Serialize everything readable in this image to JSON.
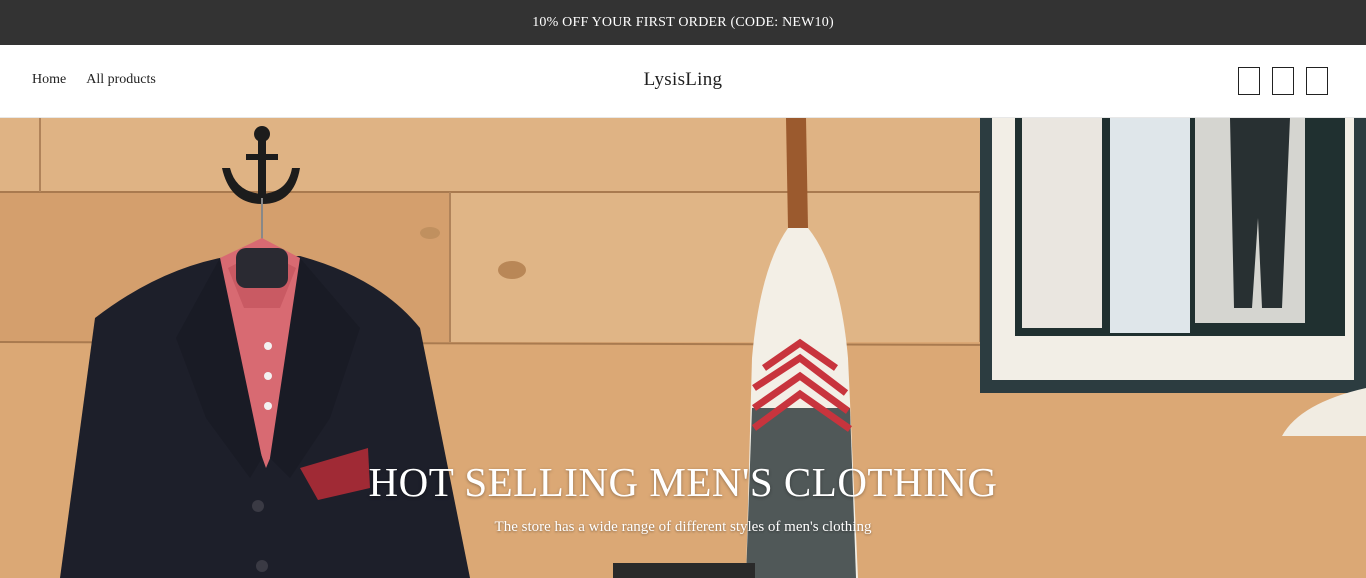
{
  "announcement": {
    "text": "10% OFF YOUR FIRST ORDER (CODE: NEW10)"
  },
  "nav": {
    "items": [
      {
        "label": "Home"
      },
      {
        "label": "All products"
      }
    ]
  },
  "brand": {
    "name": "LysisLing"
  },
  "header_icons": [
    "search-icon",
    "account-icon",
    "cart-icon"
  ],
  "hero": {
    "title": "HOT SELLING MEN'S CLOTHING",
    "subtitle": "The store has a wide range of different styles of men's clothing",
    "button_label": ""
  },
  "colors": {
    "announcement_bg": "#333333",
    "header_bg": "#ffffff",
    "accent_red": "#c8343d",
    "button_bg": "#2a2a2a"
  }
}
